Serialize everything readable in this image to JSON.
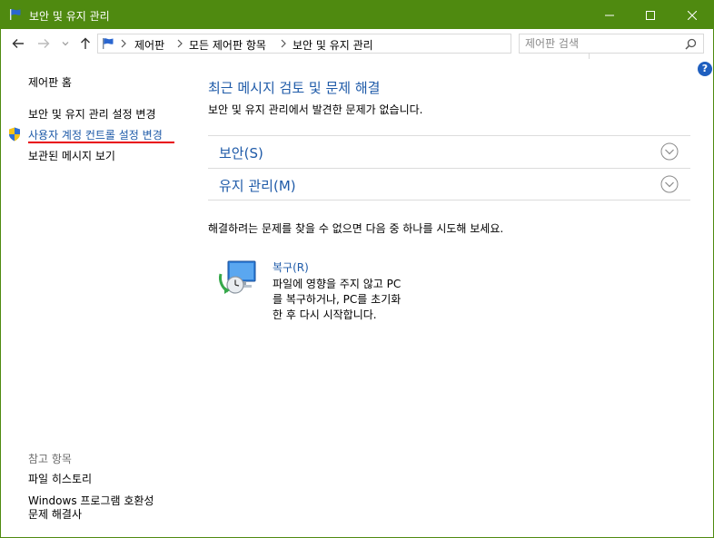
{
  "window": {
    "title": "보안 및 유지 관리"
  },
  "address": {
    "crumbs": [
      "제어판",
      "모든 제어판 항목",
      "보안 및 유지 관리"
    ],
    "search_placeholder": "제어판 검색"
  },
  "help": {
    "label": "?"
  },
  "sidebar": {
    "items": [
      {
        "label": "제어판 홈"
      },
      {
        "label": "보안 및 유지 관리 설정 변경"
      },
      {
        "label": "사용자 계정 컨트롤 설정 변경"
      },
      {
        "label": "보관된 메시지 보기"
      }
    ],
    "see_also_title": "참고 항목",
    "see_also": [
      {
        "label": "파일 히스토리"
      },
      {
        "label": "Windows 프로그램 호환성"
      },
      {
        "label": "문제 해결사"
      }
    ]
  },
  "main": {
    "title": "최근 메시지 검토 및 문제 해결",
    "subtitle": "보안 및 유지 관리에서 발견한 문제가 없습니다.",
    "sections": [
      {
        "label": "보안(S)"
      },
      {
        "label": "유지 관리(M)"
      }
    ],
    "try_text": "해결하려는 문제를 찾을 수 없으면 다음 중 하나를 시도해 보세요.",
    "recovery": {
      "link": "복구(R)",
      "desc_lines": [
        "파일에 영향을 주지 않고 PC",
        "를 복구하거나, PC를 초기화",
        "한 후 다시 시작합니다."
      ]
    }
  },
  "colors": {
    "titlebar": "#4f8a10",
    "link": "#1e5aa8",
    "highlight_underline": "#e8000b"
  }
}
